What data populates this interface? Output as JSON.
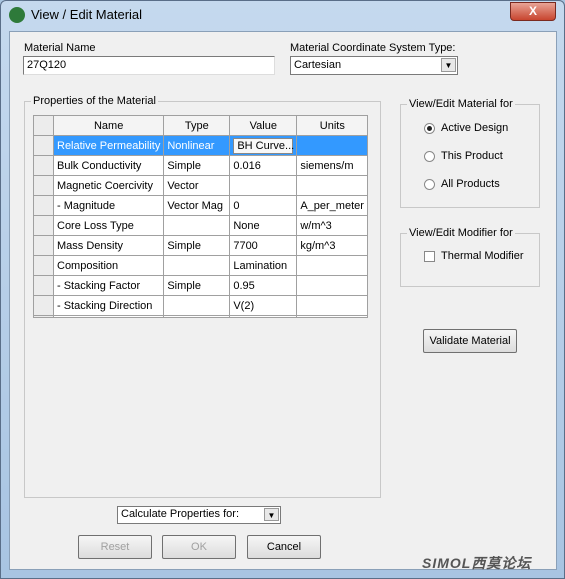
{
  "window": {
    "title": "View / Edit Material",
    "close": "X"
  },
  "material_name": {
    "label": "Material Name",
    "value": "27Q120"
  },
  "coord_system": {
    "label": "Material Coordinate System Type:",
    "value": "Cartesian"
  },
  "properties": {
    "label": "Properties of the Material",
    "columns": [
      "Name",
      "Type",
      "Value",
      "Units"
    ],
    "rows": [
      {
        "name": "Relative Permeability",
        "type": "Nonlinear",
        "value": "BH Curve...",
        "units": "",
        "selected": true
      },
      {
        "name": "Bulk Conductivity",
        "type": "Simple",
        "value": "0.016",
        "units": "siemens/m"
      },
      {
        "name": "Magnetic Coercivity",
        "type": "Vector",
        "value": "",
        "units": ""
      },
      {
        "name": "-  Magnitude",
        "type": "Vector Mag",
        "value": "0",
        "units": "A_per_meter"
      },
      {
        "name": "Core Loss Type",
        "type": "",
        "value": "None",
        "units": "w/m^3"
      },
      {
        "name": "Mass Density",
        "type": "Simple",
        "value": "7700",
        "units": "kg/m^3"
      },
      {
        "name": "Composition",
        "type": "",
        "value": "Lamination",
        "units": ""
      },
      {
        "name": "- Stacking Factor",
        "type": "Simple",
        "value": "0.95",
        "units": ""
      },
      {
        "name": "- Stacking Direction",
        "type": "",
        "value": "V(2)",
        "units": ""
      }
    ]
  },
  "view_for": {
    "label": "View/Edit Material for",
    "options": [
      "Active Design",
      "This Product",
      "All Products"
    ],
    "selected": "Active Design"
  },
  "modifier": {
    "label": "View/Edit Modifier for",
    "thermal": "Thermal Modifier",
    "checked": false
  },
  "validate": "Validate Material",
  "calculate": {
    "value": "Calculate Properties for:"
  },
  "buttons": {
    "reset": "Reset",
    "ok": "OK",
    "cancel": "Cancel"
  },
  "watermark": "SIMOL西莫论坛"
}
